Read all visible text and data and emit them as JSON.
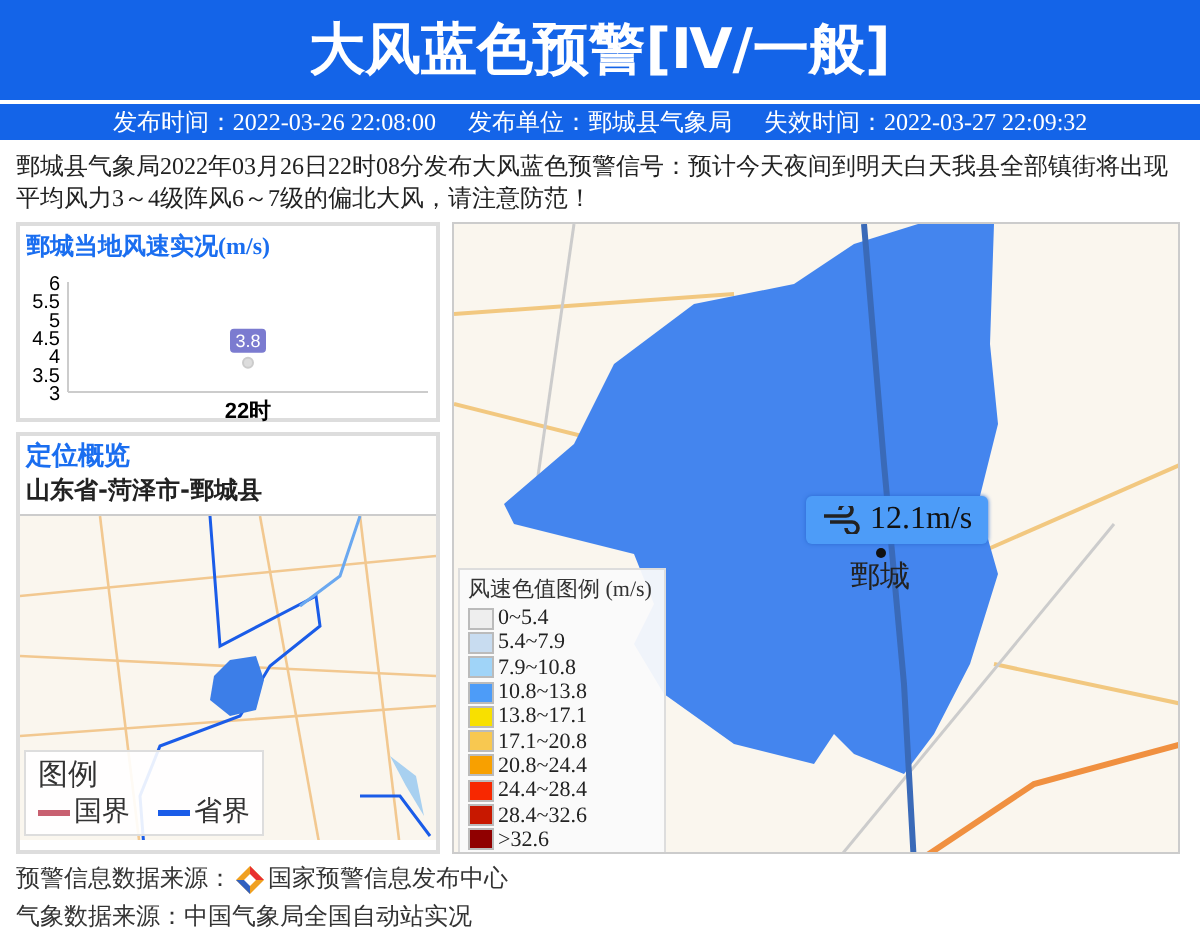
{
  "header": {
    "title": "大风蓝色预警[Ⅳ/一般]",
    "meta": [
      "发布时间：2022-03-26 22:08:00",
      "发布单位：鄄城县气象局",
      "失效时间：2022-03-27 22:09:32"
    ]
  },
  "description": "鄄城县气象局2022年03月26日22时08分发布大风蓝色预警信号：预计今天夜间到明天白天我县全部镇街将出现平均风力3～4级阵风6～7级的偏北大风，请注意防范！",
  "wind_panel": {
    "title": "鄄城当地风速实况(m/s)",
    "chart_data": {
      "type": "line",
      "categories": [
        "22时"
      ],
      "values": [
        3.8
      ],
      "marker": true,
      "ylim": [
        3,
        6
      ],
      "yticks": [
        3,
        3.5,
        4,
        4.5,
        5,
        5.5,
        6
      ],
      "data_labels": true
    }
  },
  "location_panel": {
    "title": "定位概览",
    "region": "山东省-菏泽市-鄄城县",
    "legend": {
      "title": "图例",
      "items": [
        {
          "label": "国界",
          "color": "#c86070"
        },
        {
          "label": "省界",
          "color": "#1a5ce8"
        }
      ]
    }
  },
  "wind_map": {
    "reading": "12.1m/s",
    "place": "鄄城",
    "legend": {
      "title": "风速色值图例 (m/s)",
      "items": [
        {
          "label": "0~5.4",
          "color": "#eeeeee"
        },
        {
          "label": "5.4~7.9",
          "color": "#c8dcf0"
        },
        {
          "label": "7.9~10.8",
          "color": "#a0d4f8"
        },
        {
          "label": "10.8~13.8",
          "color": "#4d9cf8"
        },
        {
          "label": "13.8~17.1",
          "color": "#f8e000"
        },
        {
          "label": "17.1~20.8",
          "color": "#f8c850"
        },
        {
          "label": "20.8~24.4",
          "color": "#f8a000"
        },
        {
          "label": "24.4~28.4",
          "color": "#f82800"
        },
        {
          "label": "28.4~32.6",
          "color": "#c81800"
        },
        {
          "label": ">32.6",
          "color": "#900000"
        }
      ]
    }
  },
  "footer": [
    {
      "kind": "logo",
      "label": "预警信息数据来源：",
      "source": "国家预警信息发布中心"
    },
    {
      "kind": "plain",
      "text": "气象数据来源：中国气象局全国自动站实况"
    }
  ]
}
